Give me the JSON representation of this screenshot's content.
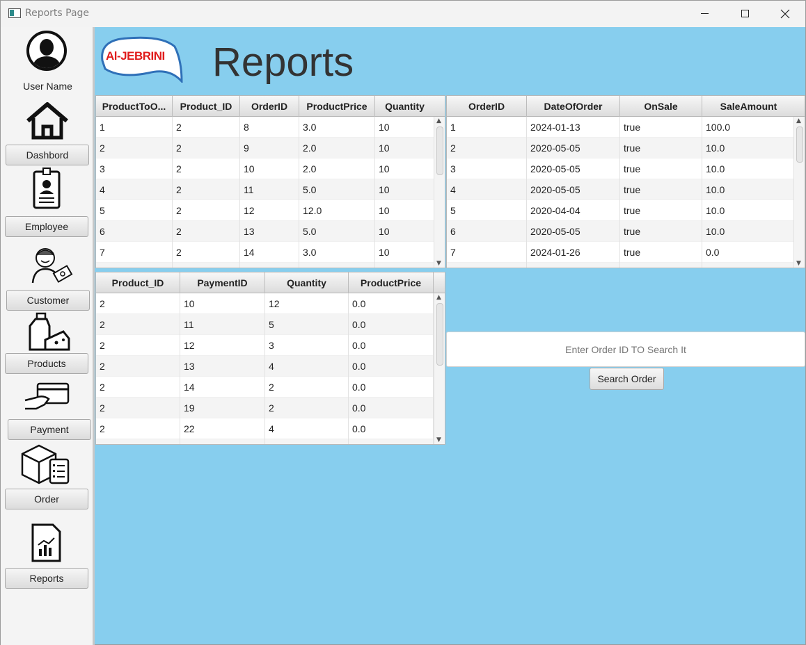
{
  "window": {
    "title": "Reports Page"
  },
  "sidebar": {
    "user_name": "User Name",
    "items": [
      {
        "label": "Dashbord",
        "icon": "home-icon"
      },
      {
        "label": "Employee",
        "icon": "id-badge-icon"
      },
      {
        "label": "Customer",
        "icon": "customer-money-icon"
      },
      {
        "label": "Products",
        "icon": "milk-cheese-icon"
      },
      {
        "label": "Payment",
        "icon": "card-payment-icon"
      },
      {
        "label": "Order",
        "icon": "box-checklist-icon"
      },
      {
        "label": "Reports",
        "icon": "report-chart-icon"
      }
    ]
  },
  "header": {
    "logo_text": "Al-JEBRINI",
    "title": "Reports"
  },
  "table_product_order": {
    "columns": [
      "ProductToO...",
      "Product_ID",
      "OrderID",
      "ProductPrice",
      "Quantity"
    ],
    "rows": [
      [
        "1",
        "2",
        "8",
        "3.0",
        "10"
      ],
      [
        "2",
        "2",
        "9",
        "2.0",
        "10"
      ],
      [
        "3",
        "2",
        "10",
        "2.0",
        "10"
      ],
      [
        "4",
        "2",
        "11",
        "5.0",
        "10"
      ],
      [
        "5",
        "2",
        "12",
        "12.0",
        "10"
      ],
      [
        "6",
        "2",
        "13",
        "5.0",
        "10"
      ],
      [
        "7",
        "2",
        "14",
        "3.0",
        "10"
      ]
    ]
  },
  "table_orders": {
    "columns": [
      "OrderID",
      "DateOfOrder",
      "OnSale",
      "SaleAmount"
    ],
    "rows": [
      [
        "1",
        "2024-01-13",
        "true",
        "100.0"
      ],
      [
        "2",
        "2020-05-05",
        "true",
        "10.0"
      ],
      [
        "3",
        "2020-05-05",
        "true",
        "10.0"
      ],
      [
        "4",
        "2020-05-05",
        "true",
        "10.0"
      ],
      [
        "5",
        "2020-04-04",
        "true",
        "10.0"
      ],
      [
        "6",
        "2020-05-05",
        "true",
        "10.0"
      ],
      [
        "7",
        "2024-01-26",
        "true",
        "0.0"
      ]
    ]
  },
  "table_payments": {
    "columns": [
      "Product_ID",
      "PaymentID",
      "Quantity",
      "ProductPrice"
    ],
    "rows": [
      [
        "2",
        "10",
        "12",
        "0.0"
      ],
      [
        "2",
        "11",
        "5",
        "0.0"
      ],
      [
        "2",
        "12",
        "3",
        "0.0"
      ],
      [
        "2",
        "13",
        "4",
        "0.0"
      ],
      [
        "2",
        "14",
        "2",
        "0.0"
      ],
      [
        "2",
        "19",
        "2",
        "0.0"
      ],
      [
        "2",
        "22",
        "4",
        "0.0"
      ]
    ]
  },
  "search": {
    "placeholder": "Enter Order ID TO Search It",
    "button_label": "Search Order"
  }
}
